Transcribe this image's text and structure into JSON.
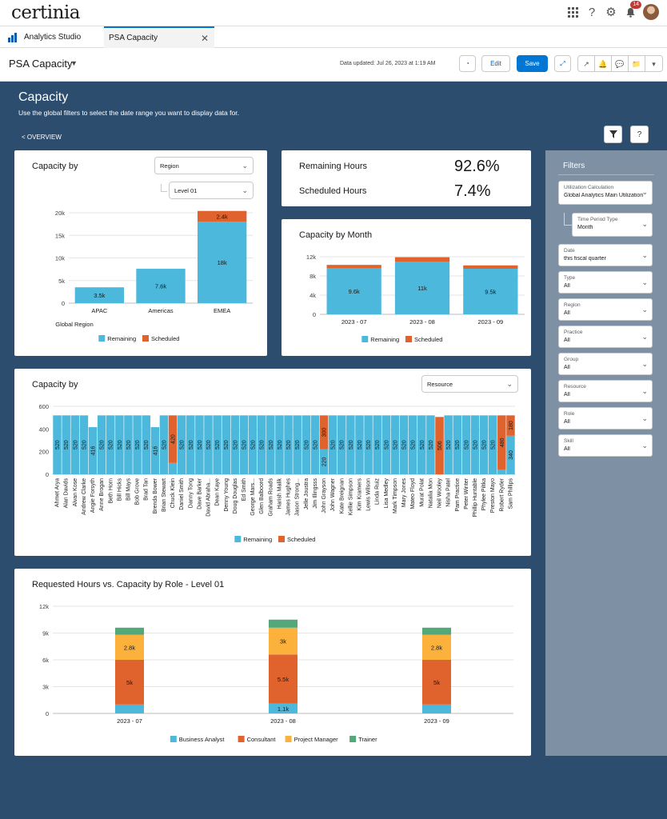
{
  "brand": "certinia",
  "topbar": {
    "notification_count": "14"
  },
  "tabs": {
    "app": "Analytics Studio",
    "active": "PSA Capacity"
  },
  "header": {
    "title": "PSA Capacity",
    "updated": "Data updated: Jul 26, 2023 at 1:19 AM",
    "edit_label": "Edit",
    "save_label": "Save"
  },
  "dashboard": {
    "title": "Capacity",
    "subtitle": "Use the global filters to select the date range you want to display data for.",
    "overview_link": "< OVERVIEW",
    "help": "?"
  },
  "colors": {
    "remaining": "#4cb8dc",
    "scheduled": "#e0622d",
    "business_analyst": "#4cb8dc",
    "consultant": "#e0622d",
    "project_manager": "#fbb13c",
    "trainer": "#52a878"
  },
  "region_card": {
    "title": "Capacity by",
    "dropdown1": "Region",
    "dropdown2": "Level 01"
  },
  "kpis": {
    "remaining_label": "Remaining Hours",
    "remaining_value": "92.6%",
    "scheduled_label": "Scheduled Hours",
    "scheduled_value": "7.4%"
  },
  "month_card": {
    "title": "Capacity by Month"
  },
  "resource_card": {
    "title": "Capacity by",
    "dropdown": "Resource"
  },
  "role_card": {
    "title": "Requested Hours vs. Capacity by Role - Level 01"
  },
  "filters": {
    "title": "Filters",
    "items": [
      {
        "label": "Utilization Calculation",
        "value": "Global Analytics Main Utilization"
      },
      {
        "label": "Time Period Type",
        "value": "Month"
      },
      {
        "label": "Date",
        "value": "this fiscal quarter"
      },
      {
        "label": "Type",
        "value": "All"
      },
      {
        "label": "Region",
        "value": "All"
      },
      {
        "label": "Practice",
        "value": "All"
      },
      {
        "label": "Group",
        "value": "All"
      },
      {
        "label": "Resource",
        "value": "All"
      },
      {
        "label": "Role",
        "value": "All"
      },
      {
        "label": "Skill",
        "value": "All"
      }
    ]
  },
  "chart_data": [
    {
      "type": "bar",
      "title": "Capacity by",
      "xlabel": "Global Region",
      "categories": [
        "APAC",
        "Americas",
        "EMEA"
      ],
      "series": [
        {
          "name": "Remaining",
          "values": [
            3500,
            7600,
            18000
          ],
          "labels": [
            "3.5k",
            "7.6k",
            "18k"
          ]
        },
        {
          "name": "Scheduled",
          "values": [
            0,
            0,
            2400
          ],
          "labels": [
            "",
            "",
            "2.4k"
          ]
        }
      ],
      "yticks": [
        "0",
        "5k",
        "10k",
        "15k",
        "20k"
      ],
      "ylim": [
        0,
        20000
      ],
      "legend": "bottom"
    },
    {
      "type": "bar",
      "title": "Capacity by Month",
      "categories": [
        "2023 - 07",
        "2023 - 08",
        "2023 - 09"
      ],
      "series": [
        {
          "name": "Remaining",
          "values": [
            9600,
            11000,
            9500
          ],
          "labels": [
            "9.6k",
            "11k",
            "9.5k"
          ]
        },
        {
          "name": "Scheduled",
          "values": [
            700,
            900,
            700
          ],
          "labels": [
            "",
            "",
            ""
          ]
        }
      ],
      "yticks": [
        "0",
        "4k",
        "8k",
        "12k"
      ],
      "ylim": [
        0,
        12000
      ],
      "legend": "bottom"
    },
    {
      "type": "bar",
      "title": "Capacity by",
      "categories": [
        "Ahmet Arya",
        "Alan Davids",
        "Alvan Kose",
        "Andrew Clarke",
        "Angie Forsyth",
        "Anne Brogan",
        "Beth Horn",
        "Bill Hicks",
        "Bill Mays",
        "Bob Grove",
        "Brad Tan",
        "Brenda Bower",
        "Brian Stewart",
        "Chuck Klein",
        "Daniel Smith",
        "Danny Tong",
        "Dave Barker",
        "David Abraha...",
        "Dean Kaye",
        "Denny Young",
        "Doug Douglas",
        "Ed Smith",
        "George Mars...",
        "Glen Balboord",
        "Graham Roads",
        "Harish Malik",
        "James Hughes",
        "Jason Strong...",
        "Jelle Joustra",
        "Jim Illingsss",
        "John Grayson",
        "John Wagner",
        "Kate Breignan",
        "Kellie Simpson",
        "Kim Kramers",
        "Lewis Wilson",
        "Linda Ruiz",
        "Lisa Medley",
        "Mark Timpson",
        "Mary Jones",
        "Mateo Floyd",
        "Murat Polat",
        "Natalia Mon",
        "Neil Wooley",
        "Nisha Patel",
        "Pam Practice",
        "Peter Winter",
        "Phillip Huntable",
        "Phylee Piltka",
        "Preston Mayo",
        "Robert Ryder",
        "Sam Phillips"
      ],
      "series": [
        {
          "name": "Remaining",
          "values": [
            520,
            520,
            520,
            520,
            416,
            520,
            520,
            520,
            520,
            520,
            520,
            416,
            520,
            100,
            520,
            520,
            520,
            520,
            520,
            520,
            520,
            520,
            520,
            520,
            520,
            520,
            520,
            520,
            520,
            520,
            220,
            520,
            520,
            520,
            520,
            520,
            520,
            520,
            520,
            520,
            520,
            520,
            520,
            0,
            520,
            520,
            520,
            520,
            520,
            520,
            40,
            340
          ],
          "labels": [
            "520",
            "520",
            "520",
            "520",
            "416",
            "520",
            "520",
            "520",
            "520",
            "520",
            "520",
            "416",
            "520",
            "",
            "520",
            "520",
            "520",
            "520",
            "520",
            "520",
            "520",
            "520",
            "520",
            "520",
            "520",
            "520",
            "520",
            "520",
            "520",
            "520",
            "220",
            "520",
            "520",
            "520",
            "520",
            "520",
            "520",
            "520",
            "520",
            "520",
            "520",
            "520",
            "520",
            "",
            "520",
            "520",
            "520",
            "520",
            "520",
            "520",
            "",
            "340"
          ]
        },
        {
          "name": "Scheduled",
          "values": [
            0,
            0,
            0,
            0,
            0,
            0,
            0,
            0,
            0,
            0,
            0,
            0,
            0,
            420,
            0,
            0,
            0,
            0,
            0,
            0,
            0,
            0,
            0,
            0,
            0,
            0,
            0,
            0,
            0,
            0,
            300,
            0,
            0,
            0,
            0,
            0,
            0,
            0,
            0,
            0,
            0,
            0,
            0,
            506,
            0,
            0,
            0,
            0,
            0,
            0,
            480,
            180
          ],
          "labels": [
            "",
            "",
            "",
            "",
            "",
            "",
            "",
            "",
            "",
            "",
            "",
            "",
            "",
            "420",
            "",
            "",
            "",
            "",
            "",
            "",
            "",
            "",
            "",
            "",
            "",
            "",
            "",
            "",
            "",
            "",
            "300",
            "",
            "",
            "",
            "",
            "",
            "",
            "",
            "",
            "",
            "",
            "",
            "",
            "506",
            "",
            "",
            "",
            "",
            "",
            "",
            "480",
            "180"
          ]
        }
      ],
      "yticks": [
        "0",
        "200",
        "400",
        "600"
      ],
      "ylim": [
        0,
        600
      ],
      "legend": "bottom"
    },
    {
      "type": "bar",
      "title": "Requested Hours vs. Capacity by Role - Level 01",
      "categories": [
        "2023 - 07",
        "2023 - 08",
        "2023 - 09"
      ],
      "series": [
        {
          "name": "Business Analyst",
          "values": [
            1000,
            1100,
            1000
          ],
          "labels": [
            "",
            "1.1k",
            ""
          ]
        },
        {
          "name": "Consultant",
          "values": [
            5000,
            5500,
            5000
          ],
          "labels": [
            "5k",
            "5.5k",
            "5k"
          ]
        },
        {
          "name": "Project Manager",
          "values": [
            2800,
            3000,
            2800
          ],
          "labels": [
            "2.8k",
            "3k",
            "2.8k"
          ]
        },
        {
          "name": "Trainer",
          "values": [
            800,
            900,
            800
          ],
          "labels": [
            "",
            "",
            ""
          ]
        }
      ],
      "yticks": [
        "0",
        "3k",
        "6k",
        "9k",
        "12k"
      ],
      "ylim": [
        0,
        12000
      ],
      "legend": "bottom"
    }
  ]
}
